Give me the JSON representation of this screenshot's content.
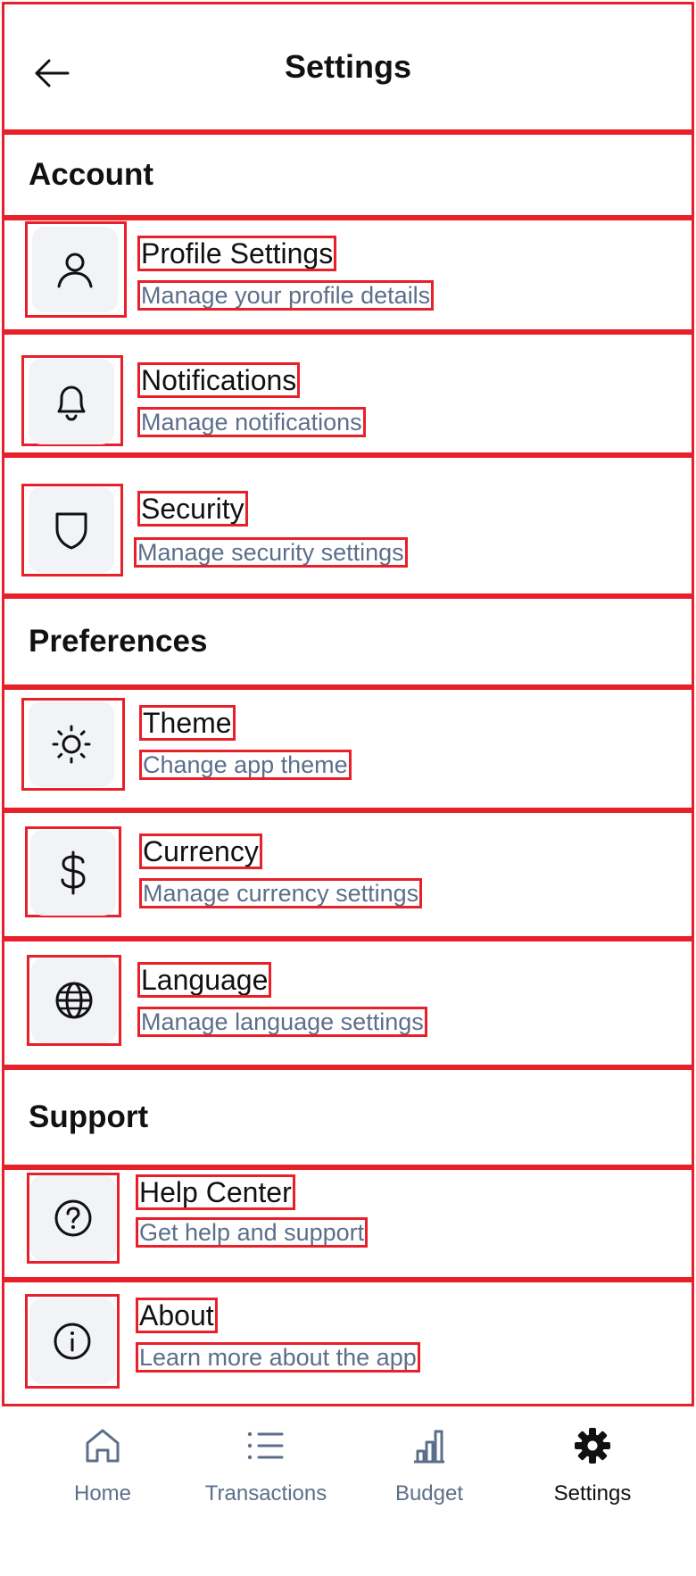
{
  "header": {
    "title": "Settings",
    "back_icon": "arrow-left-icon"
  },
  "sections": {
    "account": "Account",
    "preferences": "Preferences",
    "support": "Support"
  },
  "rows": {
    "profile": {
      "title": "Profile Settings",
      "subtitle": "Manage your profile details",
      "icon": "user-icon"
    },
    "notifications": {
      "title": "Notifications",
      "subtitle": "Manage notifications",
      "icon": "bell-icon"
    },
    "security": {
      "title": "Security",
      "subtitle": "Manage security settings",
      "icon": "shield-icon"
    },
    "theme": {
      "title": "Theme",
      "subtitle": "Change app theme",
      "icon": "sun-icon"
    },
    "currency": {
      "title": "Currency",
      "subtitle": "Manage currency settings",
      "icon": "dollar-icon"
    },
    "language": {
      "title": "Language",
      "subtitle": "Manage language settings",
      "icon": "globe-icon"
    },
    "help": {
      "title": "Help Center",
      "subtitle": "Get help and support",
      "icon": "help-circle-icon"
    },
    "about": {
      "title": "About",
      "subtitle": "Learn more about the app",
      "icon": "info-icon"
    }
  },
  "bottom_nav": {
    "home": {
      "label": "Home",
      "icon": "home-icon"
    },
    "transactions": {
      "label": "Transactions",
      "icon": "list-icon"
    },
    "budget": {
      "label": "Budget",
      "icon": "bar-chart-icon"
    },
    "settings": {
      "label": "Settings",
      "icon": "gear-icon",
      "active": true
    }
  },
  "colors": {
    "annotation": "#e8202a",
    "subtitle": "#5c6f8a",
    "icon_bg": "#f1f3f6",
    "text": "#111111"
  }
}
